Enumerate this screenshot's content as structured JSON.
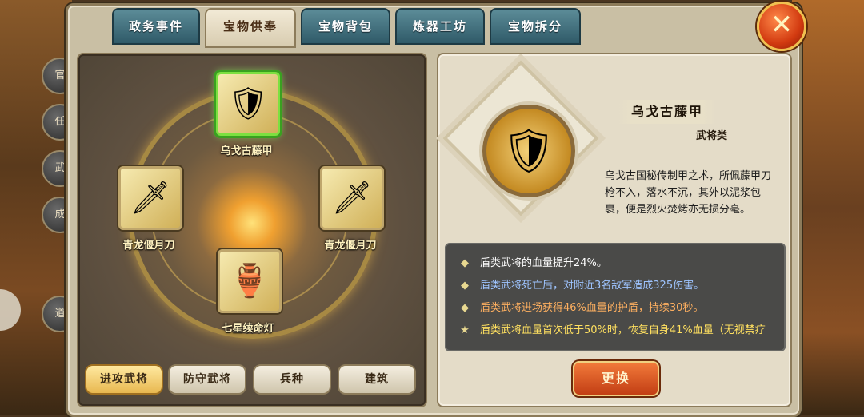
{
  "tabs": [
    {
      "label": "政务事件",
      "active": false
    },
    {
      "label": "宝物供奉",
      "active": true
    },
    {
      "label": "宝物背包",
      "active": false
    },
    {
      "label": "炼器工坊",
      "active": false
    },
    {
      "label": "宝物拆分",
      "active": false
    }
  ],
  "side_menu": [
    "官",
    "任",
    "武",
    "成",
    "道"
  ],
  "close_icon": "close-x-icon",
  "altar": {
    "top": {
      "name": "乌戈古藤甲",
      "icon": "armor-icon",
      "glyph": "🛡"
    },
    "left": {
      "name": "青龙偃月刀",
      "icon": "blade-icon",
      "glyph": "🗡"
    },
    "right": {
      "name": "青龙偃月刀",
      "icon": "blade-icon",
      "glyph": "🗡"
    },
    "bottom": {
      "name": "七星续命灯",
      "icon": "lamp-icon",
      "glyph": "🏺"
    }
  },
  "bottom_buttons": [
    {
      "label": "进攻武将",
      "active": true
    },
    {
      "label": "防守武将",
      "active": false
    },
    {
      "label": "兵种",
      "active": false
    },
    {
      "label": "建筑",
      "active": false
    }
  ],
  "detail": {
    "name": "乌戈古藤甲",
    "category": "武将类",
    "icon": "armor-icon",
    "glyph": "🛡",
    "description": "乌戈古国秘传制甲之术，所佩藤甲刀枪不入，落水不沉，其外以泥浆包裹，便是烈火焚烤亦无损分毫。"
  },
  "effects": [
    {
      "bullet": "◆",
      "text": "盾类武将的血量提升24%。",
      "color": "#ffffff"
    },
    {
      "bullet": "◆",
      "text": "盾类武将死亡后，对附近3名敌军造成325伤害。",
      "color": "#9ec4ff"
    },
    {
      "bullet": "◆",
      "text": "盾类武将进场获得46%血量的护盾，持续30秒。",
      "color": "#ffb060"
    },
    {
      "bullet": "★",
      "text": "盾类武将血量首次低于50%时，恢复自身41%血量（无视禁疗",
      "color": "#ffe060"
    }
  ],
  "swap_label": "更换"
}
